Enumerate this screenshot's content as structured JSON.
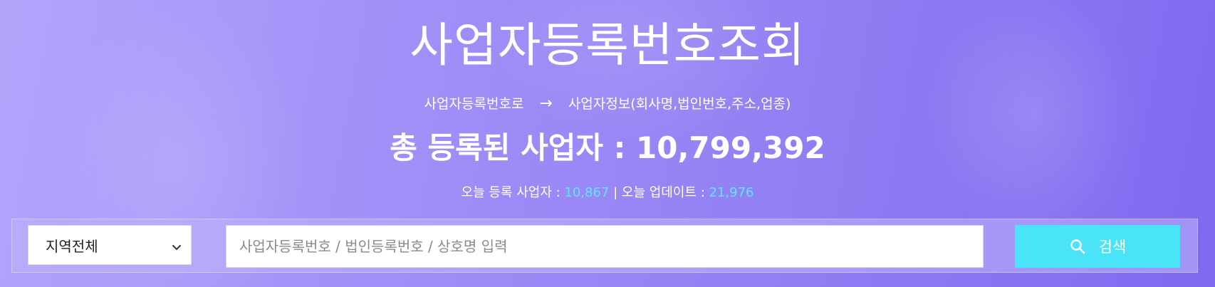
{
  "hero": {
    "title": "사업자등록번호조회",
    "subtitle_from": "사업자등록번호로",
    "subtitle_arrow": "→",
    "subtitle_to": "사업자정보(회사명,법인번호,주소,업종)",
    "total_label": "총 등록된 사업자 : ",
    "total_value": "10,799,392",
    "today_registered_label": "오늘 등록 사업자 : ",
    "today_registered_value": "10,867",
    "separator": " | ",
    "today_updated_label": "오늘 업데이트 : ",
    "today_updated_value": "21,976"
  },
  "search": {
    "region_selected": "지역전체",
    "input_placeholder": "사업자등록번호 / 법인등록번호 / 상호명 입력",
    "input_value": "",
    "button_label": "검색",
    "button_icon": "search-icon",
    "chevron_icon": "chevron-down-icon"
  },
  "colors": {
    "accent_number": "#5ee7ff",
    "button_bg": "#4ae4f8",
    "gradient_start": "#b3a4fb",
    "gradient_end": "#7f6af0"
  }
}
